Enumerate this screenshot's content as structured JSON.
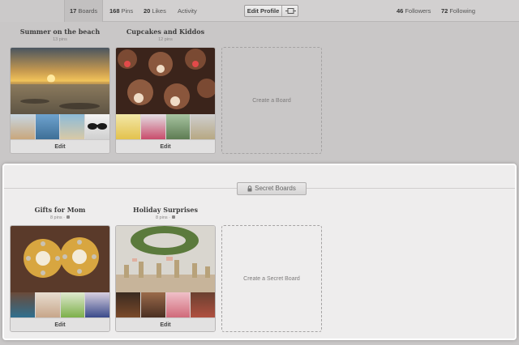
{
  "topbar": {
    "tabs": [
      {
        "count": "17",
        "label": "Boards"
      },
      {
        "count": "168",
        "label": "Pins"
      },
      {
        "count": "20",
        "label": "Likes"
      },
      {
        "count": "",
        "label": "Activity"
      }
    ],
    "edit_profile_label": "Edit Profile",
    "followers": {
      "count": "46",
      "label": "Followers"
    },
    "following": {
      "count": "72",
      "label": "Following"
    }
  },
  "boards": [
    {
      "title": "Summer on the beach",
      "pins": "13 pins",
      "edit_label": "Edit"
    },
    {
      "title": "Cupcakes and Kiddos",
      "pins": "12 pins",
      "edit_label": "Edit"
    }
  ],
  "create_board_label": "Create a Board",
  "secret": {
    "header_label": "Secret Boards",
    "boards": [
      {
        "title": "Gifts for Mom",
        "pins": "8 pins ·",
        "edit_label": "Edit"
      },
      {
        "title": "Holiday Surprises",
        "pins": "8 pins ·",
        "edit_label": "Edit"
      }
    ],
    "create_label": "Create a Secret Board"
  }
}
